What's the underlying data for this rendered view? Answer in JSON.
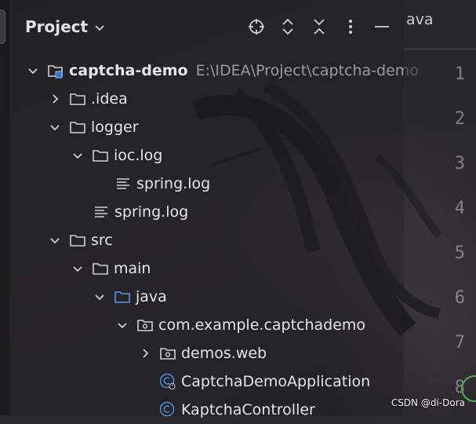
{
  "panel": {
    "title": "Project",
    "toolbar": [
      {
        "name": "locate-icon"
      },
      {
        "name": "expand-all-icon"
      },
      {
        "name": "collapse-all-icon"
      },
      {
        "name": "more-options-icon"
      },
      {
        "name": "hide-panel-icon"
      }
    ]
  },
  "editor": {
    "tab_label": "ava",
    "line_numbers": [
      "1",
      "2",
      "3",
      "4",
      "5",
      "6",
      "7",
      "8"
    ]
  },
  "tree": [
    {
      "label": "captcha-demo",
      "path": "E:\\IDEA\\Project\\captcha-demo",
      "state": "expanded",
      "icon": "module-folder-icon",
      "bold": true
    },
    {
      "label": ".idea",
      "state": "collapsed",
      "icon": "folder-icon"
    },
    {
      "label": "logger",
      "state": "expanded",
      "icon": "folder-icon"
    },
    {
      "label": "ioc.log",
      "state": "expanded",
      "icon": "folder-icon"
    },
    {
      "label": "spring.log",
      "state": "none",
      "icon": "text-file-icon"
    },
    {
      "label": "spring.log",
      "state": "none",
      "icon": "text-file-icon"
    },
    {
      "label": "src",
      "state": "expanded",
      "icon": "folder-icon"
    },
    {
      "label": "main",
      "state": "expanded",
      "icon": "folder-icon"
    },
    {
      "label": "java",
      "state": "expanded",
      "icon": "source-folder-icon"
    },
    {
      "label": "com.example.captchademo",
      "state": "expanded",
      "icon": "package-icon"
    },
    {
      "label": "demos.web",
      "state": "collapsed",
      "icon": "package-icon"
    },
    {
      "label": "CaptchaDemoApplication",
      "state": "none",
      "icon": "spring-class-icon"
    },
    {
      "label": "KaptchaController",
      "state": "none",
      "icon": "class-icon"
    }
  ],
  "watermark": "CSDN @di-Dora",
  "colors": {
    "panel_bg": "#1e1f22",
    "text": "#e3e5e9",
    "path_text": "#9a9ca3",
    "source_folder": "#4a9be8",
    "accent_blue": "#4a88d8"
  }
}
